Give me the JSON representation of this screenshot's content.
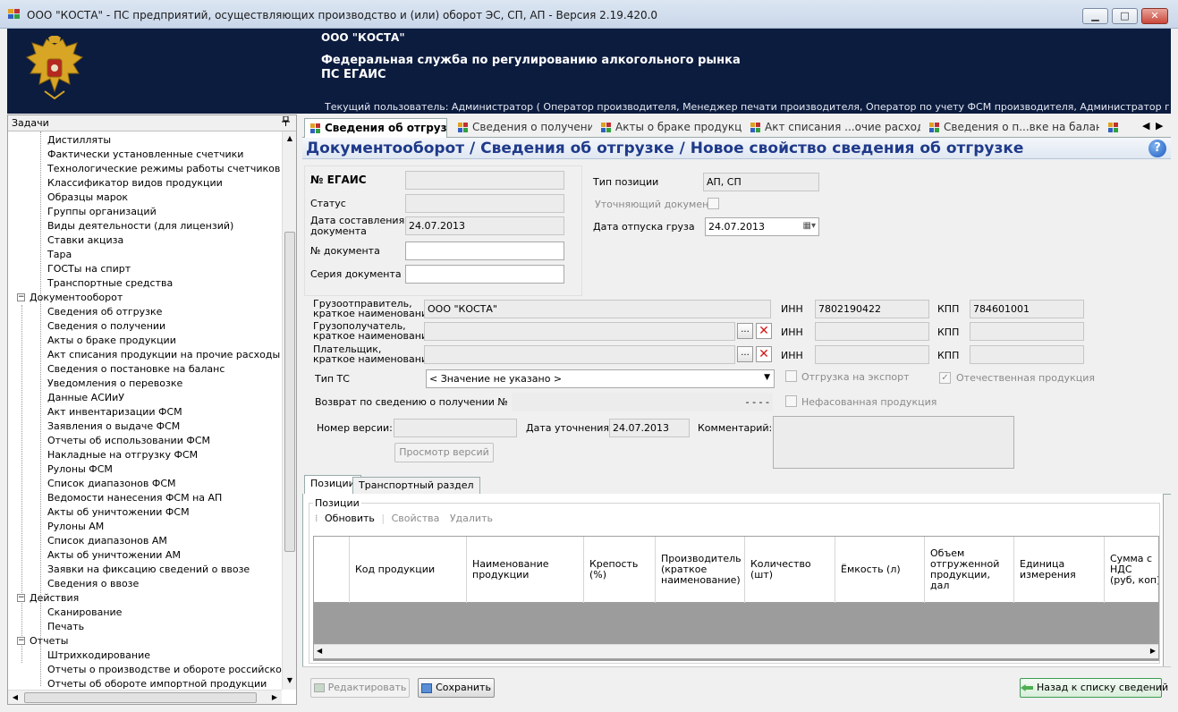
{
  "window": {
    "title": "ООО \"КОСТА\" - ПС предприятий, осуществляющих производство и (или) оборот ЭС, СП, АП - Версия 2.19.420.0",
    "min": "▁",
    "max": "□",
    "close": "✕"
  },
  "banner": {
    "org": "ООО \"КОСТА\"",
    "agency": "Федеральная служба по регулированию алкогольного рынка",
    "system": "ПС ЕГАИС",
    "user": "Текущий пользователь: Администратор ( Оператор производителя, Менеджер печати производителя, Оператор по учету ФСМ производителя, Администратор производителя, Опера..."
  },
  "tasks": {
    "title": "Задачи",
    "pin": "📌",
    "tree": [
      {
        "label": "Дистилляты",
        "level": 2
      },
      {
        "label": "Фактически установленные счетчики",
        "level": 2
      },
      {
        "label": "Технологические режимы работы счетчиков",
        "level": 2
      },
      {
        "label": "Классификатор видов продукции",
        "level": 2
      },
      {
        "label": "Образцы марок",
        "level": 2
      },
      {
        "label": "Группы организаций",
        "level": 2
      },
      {
        "label": "Виды деятельности (для лицензий)",
        "level": 2
      },
      {
        "label": "Ставки акциза",
        "level": 2
      },
      {
        "label": "Тара",
        "level": 2
      },
      {
        "label": "ГОСТы на спирт",
        "level": 2
      },
      {
        "label": "Транспортные средства",
        "level": 2
      },
      {
        "label": "Документооборот",
        "level": 1,
        "toggle": "−"
      },
      {
        "label": "Сведения об отгрузке",
        "level": 2
      },
      {
        "label": "Сведения о получении",
        "level": 2
      },
      {
        "label": "Акты о браке продукции",
        "level": 2
      },
      {
        "label": "Акт списания продукции на прочие расходы",
        "level": 2
      },
      {
        "label": "Сведения о постановке на баланс",
        "level": 2
      },
      {
        "label": "Уведомления о перевозке",
        "level": 2
      },
      {
        "label": "Данные АСИиУ",
        "level": 2
      },
      {
        "label": "Акт инвентаризации ФСМ",
        "level": 2
      },
      {
        "label": "Заявления о выдаче ФСМ",
        "level": 2
      },
      {
        "label": "Отчеты об использовании ФСМ",
        "level": 2
      },
      {
        "label": "Накладные на отгрузку ФСМ",
        "level": 2
      },
      {
        "label": "Рулоны ФСМ",
        "level": 2
      },
      {
        "label": "Список диапазонов ФСМ",
        "level": 2
      },
      {
        "label": "Ведомости нанесения ФСМ на АП",
        "level": 2
      },
      {
        "label": "Акты об уничтожении ФСМ",
        "level": 2
      },
      {
        "label": "Рулоны АМ",
        "level": 2
      },
      {
        "label": "Список диапазонов АМ",
        "level": 2
      },
      {
        "label": "Акты об уничтожении АМ",
        "level": 2
      },
      {
        "label": "Заявки на фиксацию сведений о ввозе",
        "level": 2
      },
      {
        "label": "Сведения о ввозе",
        "level": 2
      },
      {
        "label": "Действия",
        "level": 1,
        "toggle": "−"
      },
      {
        "label": "Сканирование",
        "level": 2
      },
      {
        "label": "Печать",
        "level": 2
      },
      {
        "label": "Отчеты",
        "level": 1,
        "toggle": "−"
      },
      {
        "label": "Штрихкодирование",
        "level": 2
      },
      {
        "label": "Отчеты о производстве и обороте российской продукции",
        "level": 2
      },
      {
        "label": "Отчеты об обороте импортной продукции",
        "level": 2
      }
    ],
    "scroll_up": "▲",
    "scroll_down": "▼",
    "scroll_left": "◀",
    "scroll_right": "▶"
  },
  "tabs": [
    {
      "label": "Сведения об отгрузке",
      "active": true
    },
    {
      "label": "Сведения о получении",
      "active": false
    },
    {
      "label": "Акты о браке продукции",
      "active": false
    },
    {
      "label": "Акт списания ...очие расходы",
      "active": false
    },
    {
      "label": "Сведения о п...вке на баланс",
      "active": false
    },
    {
      "label": "",
      "active": false
    }
  ],
  "tabs_prev": "◀",
  "tabs_next": "▶",
  "heading": {
    "text": "Документооборот  / Сведения об отгрузке / Новое свойство сведения об отгрузке",
    "help": "?"
  },
  "form": {
    "egais_label": "№ ЕГАИС",
    "egais_value": "",
    "status_label": "Статус",
    "status_value": "",
    "date_created_label_1": "Дата составления",
    "date_created_label_2": "документа",
    "date_created_value": "24.07.2013",
    "doc_number_label": "№ документа",
    "doc_number_value": "",
    "doc_series_label": "Серия  документа",
    "doc_series_value": "",
    "position_type_label": "Тип позиции",
    "position_type_value": "АП, СП",
    "clarifying_doc_label": "Уточняющий документ",
    "ship_date_label": "Дата отпуска груза",
    "ship_date_value": "24.07.2013",
    "calendar_icon": "▦▾",
    "shipper_label_1": "Грузоотправитель,",
    "shipper_label_2": "краткое наименование",
    "shipper_value": "ООО \"КОСТА\"",
    "consignee_label_1": "Грузополучатель,",
    "consignee_label_2": "краткое наименование",
    "consignee_value": "",
    "payer_label_1": "Плательщик,",
    "payer_label_2": "краткое наименование",
    "payer_value": "",
    "browse": "...",
    "clear": "✕",
    "inn_label": "ИНН",
    "kpp_label": "КПП",
    "shipper_inn": "7802190422",
    "shipper_kpp": "784601001",
    "consignee_inn": "",
    "consignee_kpp": "",
    "payer_inn": "",
    "payer_kpp": "",
    "ts_type_label": "Тип ТС",
    "ts_type_value": "< Значение не указано >",
    "export_label": "Отгрузка на экспорт",
    "domestic_label": "Отечественная продукция",
    "return_label": "Возврат по сведению о получении №",
    "return_value": "- - - -",
    "unpacked_label": "Нефасованная продукция",
    "version_label": "Номер версии:",
    "version_value": "",
    "clarify_date_label": "Дата уточнения:",
    "clarify_date_value": "24.07.2013",
    "comment_label": "Комментарий:",
    "comment_value": "",
    "view_versions_btn": "Просмотр версий"
  },
  "positions": {
    "tab_positions": "Позиции",
    "tab_transport": "Транспортный раздел",
    "group_title": "Позиции",
    "refresh": "Обновить",
    "properties": "Свойства",
    "delete": "Удалить",
    "columns": [
      "Код продукции",
      "Наименование\nпродукции",
      "Крепость\n(%)",
      "Производитель\n(краткое\nнаименование)",
      "Количество\n(шт)",
      "Ёмкость (л)",
      "Объем\nотгруженной\nпродукции,\nдал",
      "Единица\nизмерения",
      "Сумма с НДС\n(руб, коп)"
    ]
  },
  "bottom": {
    "edit": "Редактировать",
    "save": "Сохранить",
    "back": "Назад к списку сведений"
  },
  "colors": {
    "banner": "#0c1c3f",
    "heading_text": "#1f3a8a",
    "grid_empty": "#9c9c9c"
  }
}
